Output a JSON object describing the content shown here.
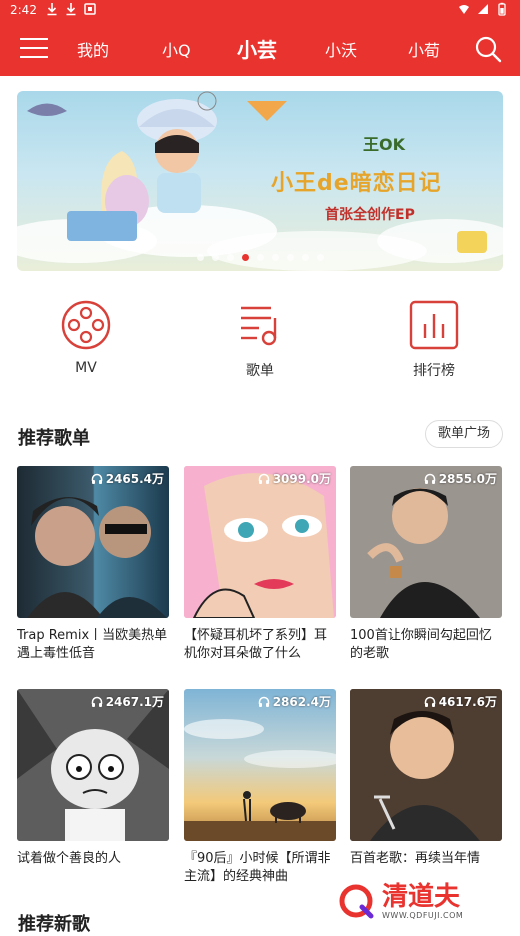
{
  "status_bar": {
    "time": "2:42"
  },
  "nav": {
    "tabs": [
      {
        "label": "我的"
      },
      {
        "label": "小Q"
      },
      {
        "label": "小芸"
      },
      {
        "label": "小沃"
      },
      {
        "label": "小荀"
      }
    ],
    "active_tab": "小芸"
  },
  "banner": {
    "title_line1": "王OK",
    "title_line2": "小王de暗恋日记",
    "title_line3": "首张全创作EP",
    "slide_count": 9,
    "active_slide": 3
  },
  "quick_links": [
    {
      "label": "MV",
      "icon": "film-reel-icon"
    },
    {
      "label": "歌单",
      "icon": "playlist-icon"
    },
    {
      "label": "排行榜",
      "icon": "chart-icon"
    }
  ],
  "recommend": {
    "title": "推荐歌单",
    "more_label": "歌单广场",
    "playlists": [
      {
        "plays": "2465.4万",
        "title": "Trap Remix丨当欧美热单遇上毒性低音"
      },
      {
        "plays": "3099.0万",
        "title": "【怀疑耳机坏了系列】耳机你对耳朵做了什么"
      },
      {
        "plays": "2855.0万",
        "title": "100首让你瞬间勾起回忆的老歌"
      },
      {
        "plays": "2467.1万",
        "title": "试着做个善良的人"
      },
      {
        "plays": "2862.4万",
        "title": "『90后』小时候【所谓非主流】的经典神曲"
      },
      {
        "plays": "4617.6万",
        "title": "百首老歌：再续当年情"
      }
    ]
  },
  "next_section": {
    "title": "推荐新歌"
  },
  "watermark": {
    "brand": "清道夫",
    "url": "WWW.QDFUJI.COM"
  },
  "colors": {
    "accent": "#e8332f"
  }
}
